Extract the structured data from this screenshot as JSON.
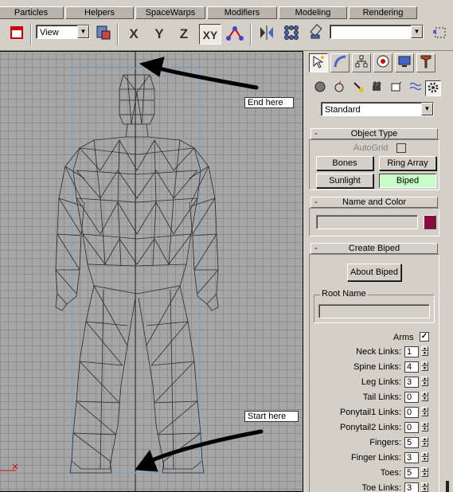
{
  "tabs": [
    "Particles",
    "Helpers",
    "SpaceWarps",
    "Modifiers",
    "Modeling",
    "Rendering"
  ],
  "toolbar": {
    "view_select": "View",
    "axis_x": "X",
    "axis_y": "Y",
    "axis_z": "Z",
    "axis_xy": "XY",
    "named_selection": ""
  },
  "viewport": {
    "callout_end": "End here",
    "callout_start": "Start here"
  },
  "panel": {
    "category_select": "Standard",
    "object_type": {
      "title": "Object Type",
      "autogrid_label": "AutoGrid",
      "buttons": [
        "Bones",
        "Ring Array",
        "Sunlight",
        "Biped"
      ]
    },
    "name_color": {
      "title": "Name and Color",
      "name_value": "",
      "swatch_color": "#8b0a3a"
    },
    "create_biped": {
      "title": "Create Biped",
      "about_button": "About Biped",
      "root_name_label": "Root Name",
      "root_name_value": "",
      "arms_label": "Arms",
      "arms_checked": "✓",
      "params": [
        {
          "label": "Neck Links:",
          "value": "1"
        },
        {
          "label": "Spine Links:",
          "value": "4"
        },
        {
          "label": "Leg Links:",
          "value": "3"
        },
        {
          "label": "Tail Links:",
          "value": "0"
        },
        {
          "label": "Ponytail1 Links:",
          "value": "0"
        },
        {
          "label": "Ponytail2 Links:",
          "value": "0"
        },
        {
          "label": "Fingers:",
          "value": "5"
        },
        {
          "label": "Finger Links:",
          "value": "3"
        },
        {
          "label": "Toes:",
          "value": "5"
        },
        {
          "label": "Toe Links:",
          "value": "3"
        }
      ]
    }
  },
  "colors": {
    "biped_active": "#c8ffc8",
    "viewport_bg": "#a6a6a6"
  }
}
